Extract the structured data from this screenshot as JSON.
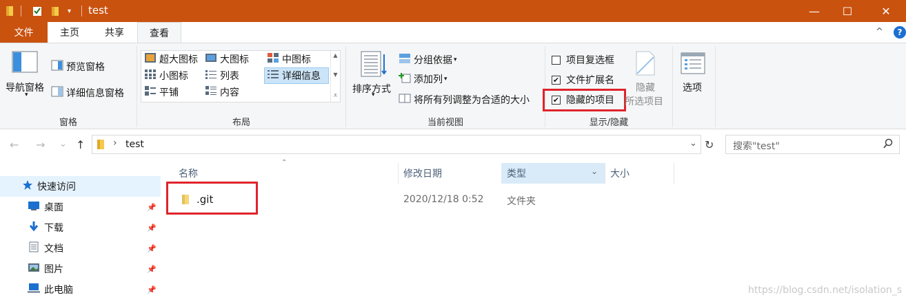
{
  "title_bar": {
    "title": "test",
    "quick_access_icons": [
      "folder-icon",
      "properties-check-icon",
      "new-folder-icon",
      "customize-dropdown-icon"
    ],
    "minimize": "—",
    "maximize": "☐",
    "close": "✕",
    "color": "#c9520f"
  },
  "tabs": [
    {
      "label": "文件",
      "active": false
    },
    {
      "label": "主页",
      "active": false
    },
    {
      "label": "共享",
      "active": false
    },
    {
      "label": "查看",
      "active": true
    }
  ],
  "ribbon": {
    "collapse_glyph": "^",
    "help_glyph": "?",
    "panes": {
      "label": "窗格",
      "navigation_pane": "导航窗格",
      "preview_pane": "预览窗格",
      "details_pane": "详细信息窗格"
    },
    "layout": {
      "label": "布局",
      "options": [
        "超大图标",
        "大图标",
        "中图标",
        "小图标",
        "列表",
        "详细信息",
        "平铺",
        "内容"
      ],
      "selected": "详细信息"
    },
    "current_view": {
      "label": "当前视图",
      "sort_by": "排序方式",
      "group_by": "分组依据",
      "add_columns": "添加列",
      "size_all_columns": "将所有列调整为合适的大小"
    },
    "show_hide": {
      "label": "显示/隐藏",
      "item_check_boxes": {
        "label": "项目复选框",
        "checked": false
      },
      "file_name_extensions": {
        "label": "文件扩展名",
        "checked": true
      },
      "hidden_items": {
        "label": "隐藏的项目",
        "checked": true
      },
      "hide_selected_line1": "隐藏",
      "hide_selected_line2": "所选项目"
    },
    "options": "选项"
  },
  "address_bar": {
    "back": "←",
    "forward": "→",
    "recent": "⌄",
    "up": "↑",
    "path_separator": "›",
    "path": "test",
    "dropdown": "⌄",
    "refresh": "↻",
    "search_placeholder": "搜索\"test\""
  },
  "nav_pane": {
    "items": [
      {
        "label": "快速访问",
        "icon": "star-icon",
        "pinned": false,
        "selected": true
      },
      {
        "label": "桌面",
        "icon": "desktop-icon",
        "pinned": true
      },
      {
        "label": "下载",
        "icon": "download-icon",
        "pinned": true
      },
      {
        "label": "文档",
        "icon": "document-icon",
        "pinned": true
      },
      {
        "label": "图片",
        "icon": "pictures-icon",
        "pinned": true
      },
      {
        "label": "此电脑",
        "icon": "computer-icon",
        "pinned": true
      }
    ]
  },
  "file_list": {
    "columns": [
      "名称",
      "修改日期",
      "类型",
      "大小"
    ],
    "sorted_column": "类型",
    "rows": [
      {
        "name": ".git",
        "modified": "2020/12/18 0:52",
        "type": "文件夹",
        "size": ""
      }
    ]
  },
  "watermark": "https://blog.csdn.net/isolation_s",
  "colors": {
    "accent": "#c9520f",
    "highlight_red": "#e0232b",
    "selection_blue": "#cce4f7"
  }
}
